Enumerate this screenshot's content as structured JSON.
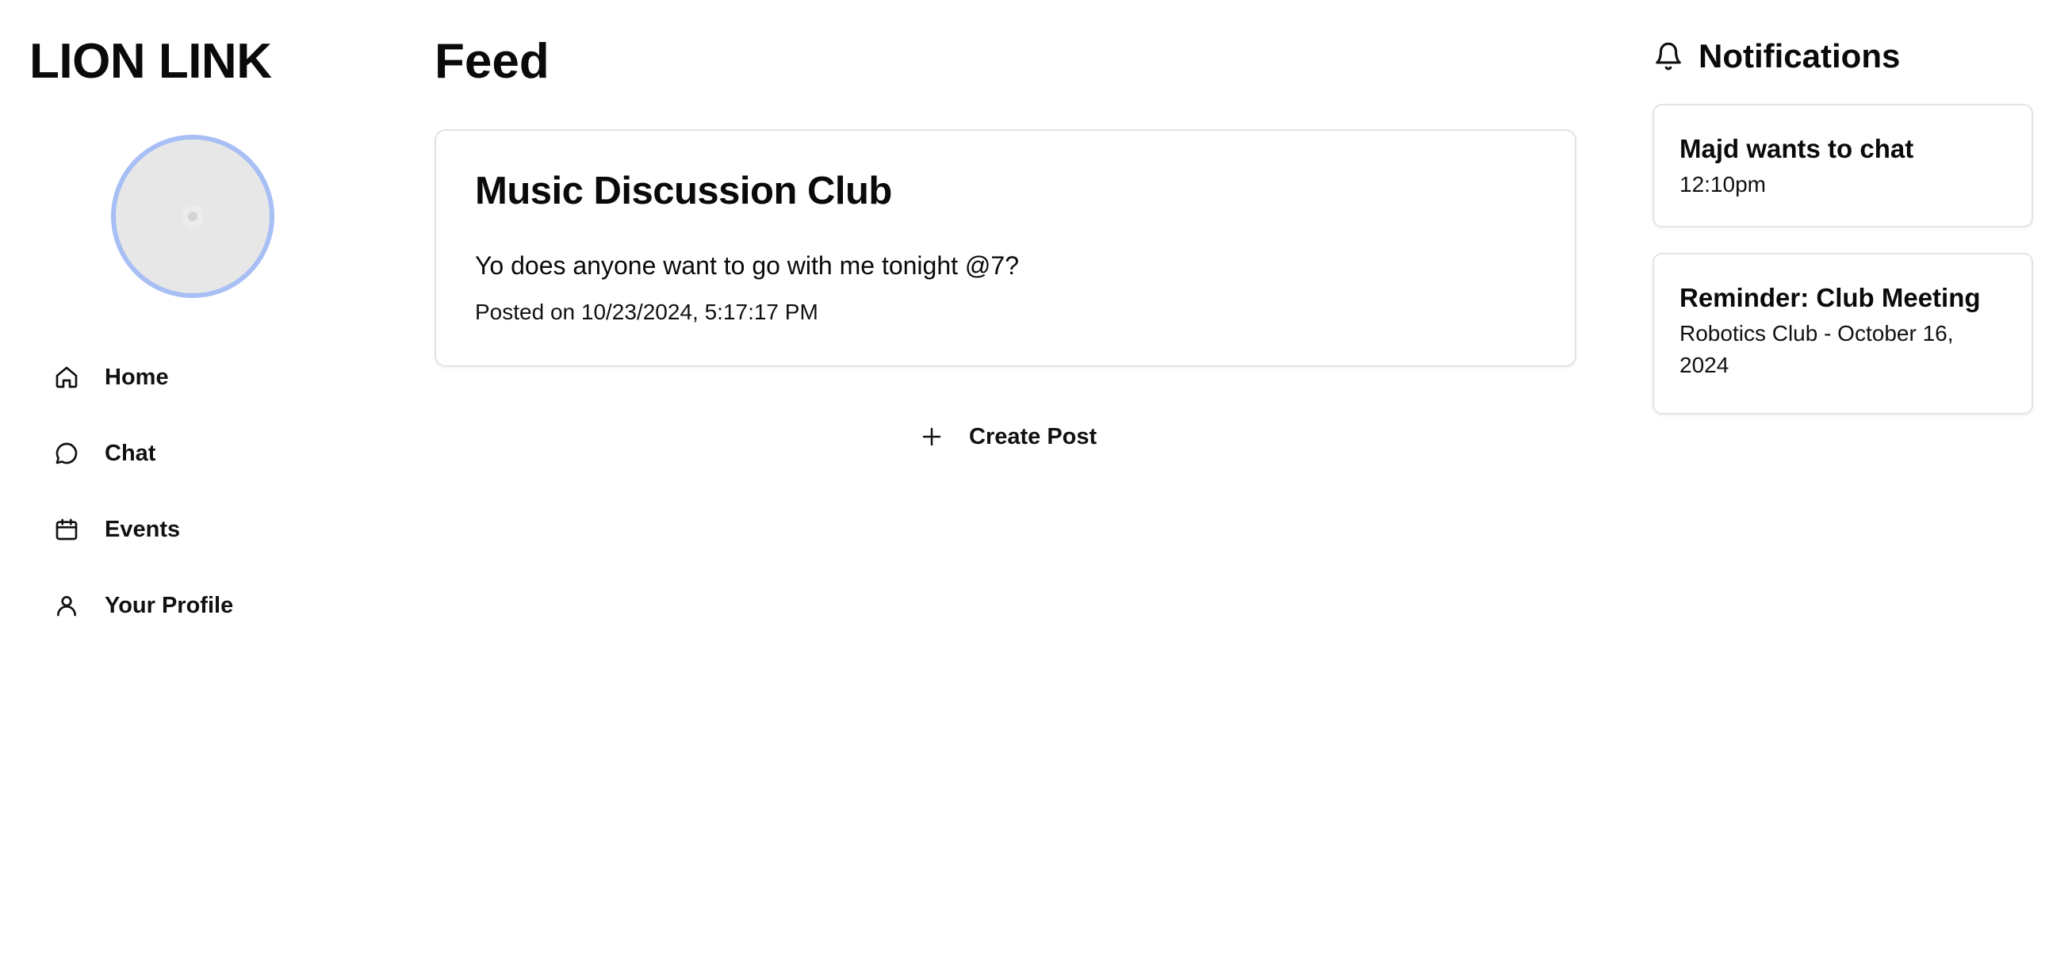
{
  "sidebar": {
    "brand": "LION LINK",
    "nav": [
      {
        "label": "Home",
        "icon": "home-icon"
      },
      {
        "label": "Chat",
        "icon": "chat-icon"
      },
      {
        "label": "Events",
        "icon": "calendar-icon"
      },
      {
        "label": "Your Profile",
        "icon": "user-icon"
      }
    ]
  },
  "main": {
    "title": "Feed",
    "post": {
      "title": "Music Discussion Club",
      "body": "Yo does anyone want to go with me tonight @7?",
      "date": "Posted on 10/23/2024, 5:17:17 PM"
    },
    "create_post_label": "Create Post"
  },
  "notifications": {
    "title": "Notifications",
    "items": [
      {
        "title": "Majd wants to chat",
        "subtitle": "12:10pm"
      },
      {
        "title": "Reminder: Club Meeting",
        "subtitle": "Robotics Club - October 16, 2024"
      }
    ]
  },
  "colors": {
    "avatar_ring": "#a8bff5",
    "avatar_fill": "#e7e7e7",
    "card_border": "#e3e3e3",
    "text": "#0a0a0a"
  }
}
